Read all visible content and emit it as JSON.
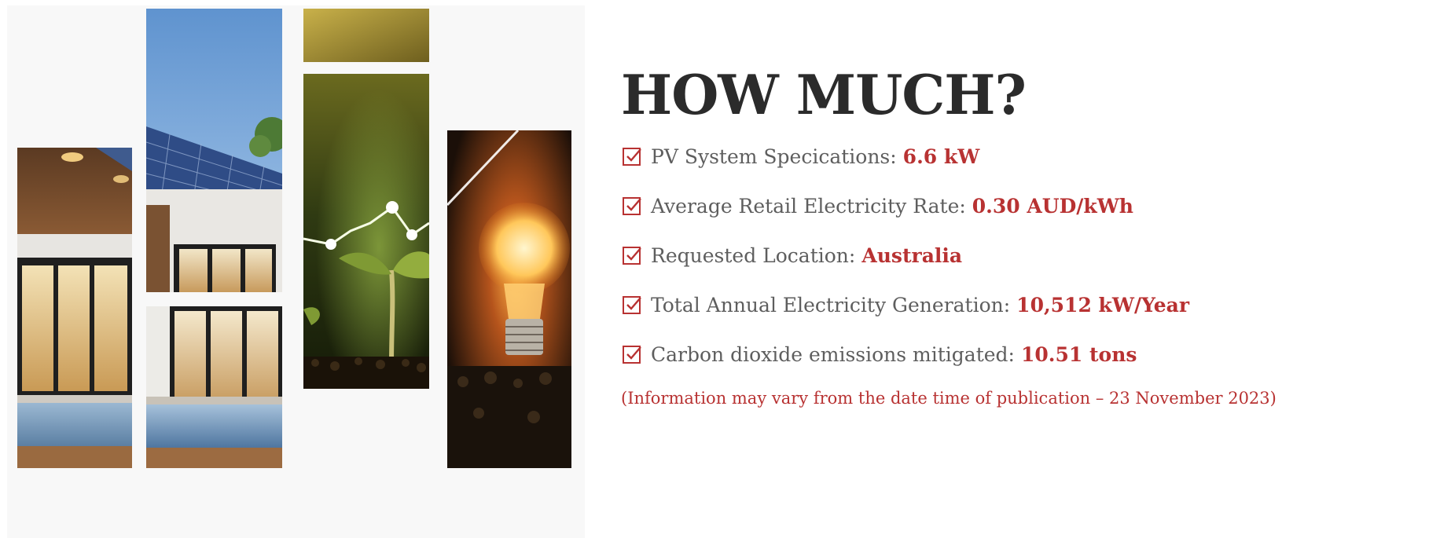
{
  "heading": "HOW MUCH?",
  "specs": [
    {
      "label": "PV System Specications:",
      "value": "6.6 kW"
    },
    {
      "label": "Average Retail Electricity Rate:",
      "value": "0.30 AUD/kWh"
    },
    {
      "label": "Requested Location:",
      "value": "Australia"
    },
    {
      "label": "Total Annual Electricity Generation:",
      "value": "10,512 kW/Year"
    },
    {
      "label": "Carbon dioxide emissions mitigated:",
      "value": "10.51 tons"
    }
  ],
  "note": "(Information may vary from the date time of publication – 23 November 2023)",
  "icons": {
    "spec_marker": "checkbox-check-icon"
  },
  "colors": {
    "accent": "#b83232",
    "heading": "#2b2b2b",
    "body_text": "#5e5e5e"
  },
  "collage_images": [
    "modern-house-with-solar-panels",
    "plant-sprout-with-energy-graph",
    "glowing-light-bulb"
  ]
}
